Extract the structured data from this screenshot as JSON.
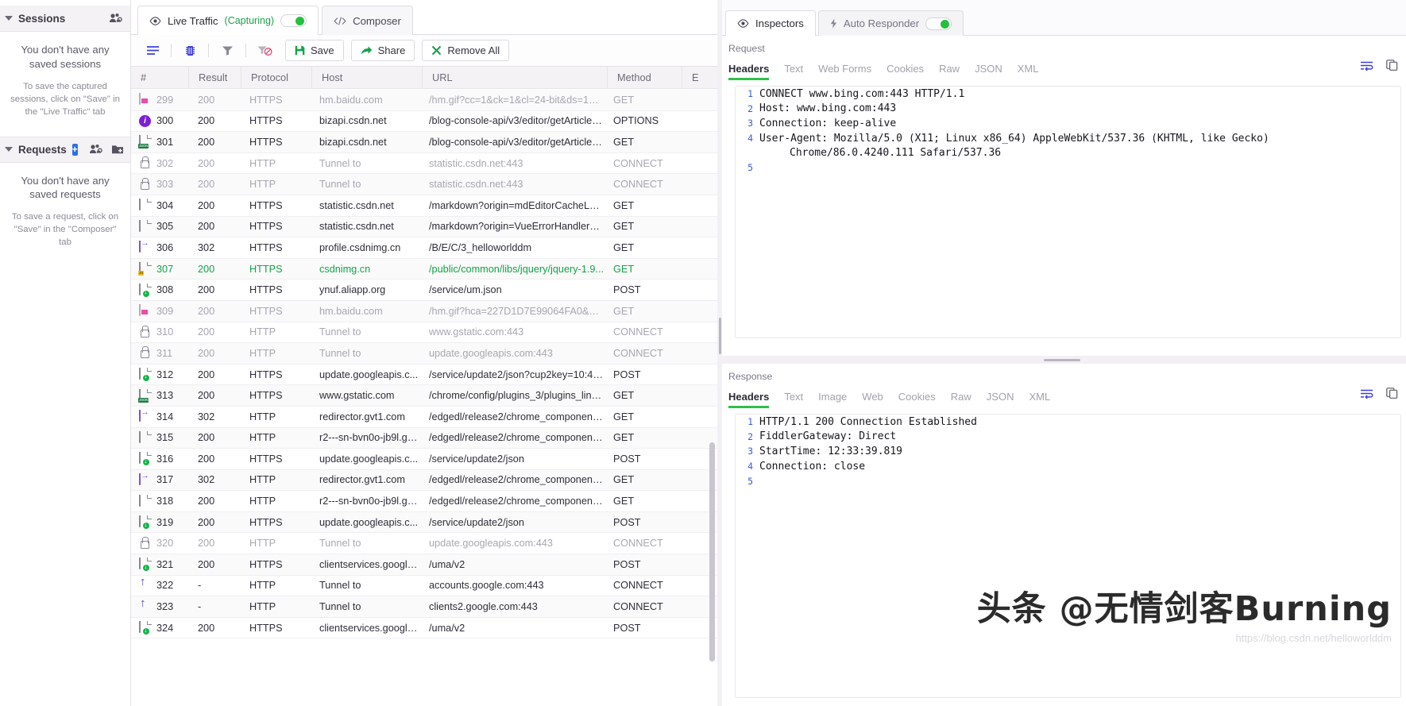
{
  "sidebar": {
    "sessions": {
      "title": "Sessions",
      "icon": "sessions-share-icon",
      "empty_title": "You don't have any saved sessions",
      "empty_hint": "To save the captured sessions, click on \"Save\" in the \"Live Traffic\" tab"
    },
    "requests": {
      "title": "Requests",
      "add_label": "+",
      "icon_share": "requests-share-icon",
      "icon_folder": "new-folder-icon",
      "empty_title": "You don't have any saved requests",
      "empty_hint": "To save a request, click on \"Save\" in the \"Composer\" tab"
    }
  },
  "center": {
    "tabs": [
      {
        "label": "Live Traffic",
        "sub": "(Capturing)",
        "icon": "eye-icon",
        "active": true,
        "has_toggle": true
      },
      {
        "label": "Composer",
        "sub": "",
        "icon": "code-icon",
        "active": false,
        "has_toggle": false
      }
    ],
    "toolbar": {
      "icons": [
        "list-view-icon",
        "columns-icon",
        "filter-icon",
        "clear-filter-icon"
      ],
      "actions": [
        {
          "label": "Save",
          "icon": "save-icon",
          "color": "#17a24a"
        },
        {
          "label": "Share",
          "icon": "share-icon",
          "color": "#17a24a"
        },
        {
          "label": "Remove All",
          "icon": "close-x-icon",
          "color": "#17a24a"
        }
      ]
    },
    "columns": [
      "#",
      "Result",
      "Protocol",
      "Host",
      "URL",
      "Method",
      "E"
    ],
    "rows": [
      {
        "icon": "image-file-icon",
        "num": "299",
        "result": "200",
        "protocol": "HTTPS",
        "host": "hm.baidu.com",
        "url": "/hm.gif?cc=1&ck=1&cl=24-bit&ds=192...",
        "method": "GET",
        "style": "dim"
      },
      {
        "icon": "info-icon",
        "num": "300",
        "result": "200",
        "protocol": "HTTPS",
        "host": "bizapi.csdn.net",
        "url": "/blog-console-api/v3/editor/getArticle?...",
        "method": "OPTIONS",
        "style": ""
      },
      {
        "icon": "json-file-icon",
        "num": "301",
        "result": "200",
        "protocol": "HTTPS",
        "host": "bizapi.csdn.net",
        "url": "/blog-console-api/v3/editor/getArticle?...",
        "method": "GET",
        "style": ""
      },
      {
        "icon": "lock-icon",
        "num": "302",
        "result": "200",
        "protocol": "HTTP",
        "host": "Tunnel to",
        "url": "statistic.csdn.net:443",
        "method": "CONNECT",
        "style": "dim"
      },
      {
        "icon": "lock-icon",
        "num": "303",
        "result": "200",
        "protocol": "HTTP",
        "host": "Tunnel to",
        "url": "statistic.csdn.net:443",
        "method": "CONNECT",
        "style": "dim"
      },
      {
        "icon": "doc-file-icon",
        "num": "304",
        "result": "200",
        "protocol": "HTTPS",
        "host": "statistic.csdn.net",
        "url": "/markdown?origin=mdEditorCacheLog...",
        "method": "GET",
        "style": ""
      },
      {
        "icon": "doc-file-icon",
        "num": "305",
        "result": "200",
        "protocol": "HTTPS",
        "host": "statistic.csdn.net",
        "url": "/markdown?origin=VueErrorHandler&...",
        "method": "GET",
        "style": ""
      },
      {
        "icon": "redirect-icon",
        "num": "306",
        "result": "302",
        "protocol": "HTTPS",
        "host": "profile.csdnimg.cn",
        "url": "/B/E/C/3_helloworlddm",
        "method": "GET",
        "style": ""
      },
      {
        "icon": "js-file-icon",
        "num": "307",
        "result": "200",
        "protocol": "HTTPS",
        "host": "csdnimg.cn",
        "url": "/public/common/libs/jquery/jquery-1.9...",
        "method": "GET",
        "style": "green"
      },
      {
        "icon": "download-file-icon",
        "num": "308",
        "result": "200",
        "protocol": "HTTPS",
        "host": "ynuf.aliapp.org",
        "url": "/service/um.json",
        "method": "POST",
        "style": ""
      },
      {
        "icon": "image-file-icon",
        "num": "309",
        "result": "200",
        "protocol": "HTTPS",
        "host": "hm.baidu.com",
        "url": "/hm.gif?hca=227D1D7E99064FA0&cc=...",
        "method": "GET",
        "style": "dim"
      },
      {
        "icon": "lock-icon",
        "num": "310",
        "result": "200",
        "protocol": "HTTP",
        "host": "Tunnel to",
        "url": "www.gstatic.com:443",
        "method": "CONNECT",
        "style": "dim"
      },
      {
        "icon": "lock-icon",
        "num": "311",
        "result": "200",
        "protocol": "HTTP",
        "host": "Tunnel to",
        "url": "update.googleapis.com:443",
        "method": "CONNECT",
        "style": "dim"
      },
      {
        "icon": "download-file-icon",
        "num": "312",
        "result": "200",
        "protocol": "HTTPS",
        "host": "update.googleapis.c...",
        "url": "/service/update2/json?cup2key=10:42...",
        "method": "POST",
        "style": ""
      },
      {
        "icon": "json-file-icon",
        "num": "313",
        "result": "200",
        "protocol": "HTTPS",
        "host": "www.gstatic.com",
        "url": "/chrome/config/plugins_3/plugins_linu...",
        "method": "GET",
        "style": ""
      },
      {
        "icon": "redirect-icon",
        "num": "314",
        "result": "302",
        "protocol": "HTTP",
        "host": "redirector.gvt1.com",
        "url": "/edgedl/release2/chrome_component/...",
        "method": "GET",
        "style": ""
      },
      {
        "icon": "doc-file-icon",
        "num": "315",
        "result": "200",
        "protocol": "HTTP",
        "host": "r2---sn-bvn0o-jb9l.gv...",
        "url": "/edgedl/release2/chrome_component/...",
        "method": "GET",
        "style": ""
      },
      {
        "icon": "download-file-icon",
        "num": "316",
        "result": "200",
        "protocol": "HTTPS",
        "host": "update.googleapis.c...",
        "url": "/service/update2/json",
        "method": "POST",
        "style": ""
      },
      {
        "icon": "redirect-icon",
        "num": "317",
        "result": "302",
        "protocol": "HTTP",
        "host": "redirector.gvt1.com",
        "url": "/edgedl/release2/chrome_component/...",
        "method": "GET",
        "style": ""
      },
      {
        "icon": "doc-file-icon",
        "num": "318",
        "result": "200",
        "protocol": "HTTP",
        "host": "r2---sn-bvn0o-jb9l.gv...",
        "url": "/edgedl/release2/chrome_component/...",
        "method": "GET",
        "style": ""
      },
      {
        "icon": "download-file-icon",
        "num": "319",
        "result": "200",
        "protocol": "HTTPS",
        "host": "update.googleapis.c...",
        "url": "/service/update2/json",
        "method": "POST",
        "style": ""
      },
      {
        "icon": "lock-icon",
        "num": "320",
        "result": "200",
        "protocol": "HTTP",
        "host": "Tunnel to",
        "url": "update.googleapis.com:443",
        "method": "CONNECT",
        "style": "dim"
      },
      {
        "icon": "download-file-icon",
        "num": "321",
        "result": "200",
        "protocol": "HTTPS",
        "host": "clientservices.google...",
        "url": "/uma/v2",
        "method": "POST",
        "style": ""
      },
      {
        "icon": "upload-icon",
        "num": "322",
        "result": "-",
        "protocol": "HTTP",
        "host": "Tunnel to",
        "url": "accounts.google.com:443",
        "method": "CONNECT",
        "style": ""
      },
      {
        "icon": "upload-icon",
        "num": "323",
        "result": "-",
        "protocol": "HTTP",
        "host": "Tunnel to",
        "url": "clients2.google.com:443",
        "method": "CONNECT",
        "style": ""
      },
      {
        "icon": "download-file-icon",
        "num": "324",
        "result": "200",
        "protocol": "HTTPS",
        "host": "clientservices.google...",
        "url": "/uma/v2",
        "method": "POST",
        "style": ""
      }
    ]
  },
  "right": {
    "tabs": [
      {
        "label": "Inspectors",
        "icon": "eye-icon",
        "active": true,
        "has_toggle": false
      },
      {
        "label": "Auto Responder",
        "icon": "bolt-icon",
        "active": false,
        "has_toggle": true
      }
    ],
    "request": {
      "section_label": "Request",
      "subtabs": [
        "Headers",
        "Text",
        "Web Forms",
        "Cookies",
        "Raw",
        "JSON",
        "XML"
      ],
      "active_subtab": "Headers",
      "tools": [
        "word-wrap-icon",
        "copy-icon"
      ],
      "lines": [
        {
          "n": "1",
          "text": "CONNECT www.bing.com:443 HTTP/1.1",
          "cont": false
        },
        {
          "n": "2",
          "text": "Host: www.bing.com:443",
          "cont": false
        },
        {
          "n": "3",
          "text": "Connection: keep-alive",
          "cont": false
        },
        {
          "n": "4",
          "text": "User-Agent: Mozilla/5.0 (X11; Linux x86_64) AppleWebKit/537.36 (KHTML, like Gecko)",
          "cont": false
        },
        {
          "n": "",
          "text": "Chrome/86.0.4240.111 Safari/537.36",
          "cont": true
        },
        {
          "n": "5",
          "text": "",
          "cont": false
        }
      ]
    },
    "response": {
      "section_label": "Response",
      "subtabs": [
        "Headers",
        "Text",
        "Image",
        "Web",
        "Cookies",
        "Raw",
        "JSON",
        "XML"
      ],
      "active_subtab": "Headers",
      "tools": [
        "word-wrap-icon",
        "copy-icon"
      ],
      "lines": [
        {
          "n": "1",
          "text": "HTTP/1.1 200 Connection Established",
          "cont": false
        },
        {
          "n": "2",
          "text": "FiddlerGateway: Direct",
          "cont": false
        },
        {
          "n": "3",
          "text": "StartTime: 12:33:39.819",
          "cont": false
        },
        {
          "n": "4",
          "text": "Connection: close",
          "cont": false
        },
        {
          "n": "5",
          "text": "",
          "cont": false
        }
      ]
    }
  },
  "watermark": {
    "main": "头条 @无情剑客Burning",
    "sub": "https://blog.csdn.net/helloworlddm"
  },
  "colors": {
    "accent_green": "#2ec04c",
    "accent_blue": "#3b5bdb",
    "capture_green": "#1ea04a",
    "dim_text": "#a9a6b0"
  }
}
